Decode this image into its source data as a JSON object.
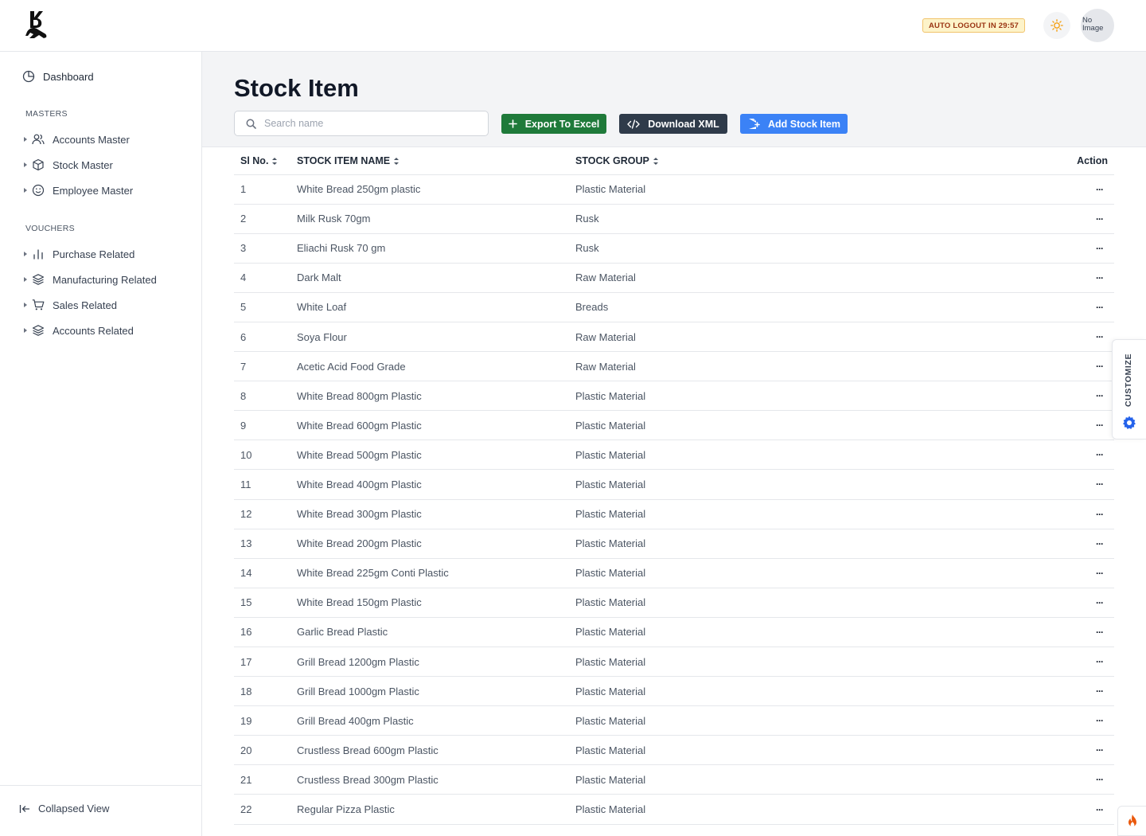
{
  "header": {
    "auto_logout": "AUTO LOGOUT IN 29:57",
    "avatar_text_line1": "No",
    "avatar_text_line2": "Image"
  },
  "sidebar": {
    "dashboard": "Dashboard",
    "masters_label": "MASTERS",
    "masters": [
      "Accounts Master",
      "Stock Master",
      "Employee Master"
    ],
    "vouchers_label": "VOUCHERS",
    "vouchers": [
      "Purchase Related",
      "Manufacturing Related",
      "Sales Related",
      "Accounts Related"
    ],
    "collapse": "Collapsed View"
  },
  "page": {
    "title": "Stock Item",
    "search_placeholder": "Search name",
    "search_value": "",
    "export_label": "Export To Excel",
    "xml_label": "Download XML",
    "add_label": "Add Stock Item"
  },
  "table": {
    "columns": [
      "Sl No.",
      "STOCK ITEM NAME",
      "STOCK GROUP",
      "Action"
    ],
    "action_glyph": "···",
    "rows": [
      [
        "1",
        "White Bread 250gm plastic",
        "Plastic Material"
      ],
      [
        "2",
        "Milk Rusk 70gm",
        "Rusk"
      ],
      [
        "3",
        "Eliachi Rusk 70 gm",
        "Rusk"
      ],
      [
        "4",
        "Dark Malt",
        "Raw Material"
      ],
      [
        "5",
        "White Loaf",
        "Breads"
      ],
      [
        "6",
        "Soya Flour",
        "Raw Material"
      ],
      [
        "7",
        "Acetic Acid Food Grade",
        "Raw Material"
      ],
      [
        "8",
        "White Bread 800gm Plastic",
        "Plastic Material"
      ],
      [
        "9",
        "White Bread 600gm Plastic",
        "Plastic Material"
      ],
      [
        "10",
        "White Bread 500gm Plastic",
        "Plastic Material"
      ],
      [
        "11",
        "White Bread 400gm Plastic",
        "Plastic Material"
      ],
      [
        "12",
        "White Bread 300gm Plastic",
        "Plastic Material"
      ],
      [
        "13",
        "White Bread 200gm Plastic",
        "Plastic Material"
      ],
      [
        "14",
        "White Bread 225gm Conti Plastic",
        "Plastic Material"
      ],
      [
        "15",
        "White Bread 150gm Plastic",
        "Plastic Material"
      ],
      [
        "16",
        "Garlic Bread Plastic",
        "Plastic Material"
      ],
      [
        "17",
        "Grill Bread 1200gm Plastic",
        "Plastic Material"
      ],
      [
        "18",
        "Grill Bread 1000gm Plastic",
        "Plastic Material"
      ],
      [
        "19",
        "Grill Bread 400gm Plastic",
        "Plastic Material"
      ],
      [
        "20",
        "Crustless Bread 600gm Plastic",
        "Plastic Material"
      ],
      [
        "21",
        "Crustless Bread 300gm Plastic",
        "Plastic Material"
      ],
      [
        "22",
        "Regular Pizza Plastic",
        "Plastic Material"
      ]
    ]
  },
  "floating": {
    "customize": "CUSTOMIZE"
  },
  "colors": {
    "excel": "#1f7a3a",
    "xml": "#2f3b4a",
    "add": "#3b82f6",
    "badge_bg": "#fdf3c9",
    "gear": "#2563eb",
    "fire": "#ea580c"
  }
}
